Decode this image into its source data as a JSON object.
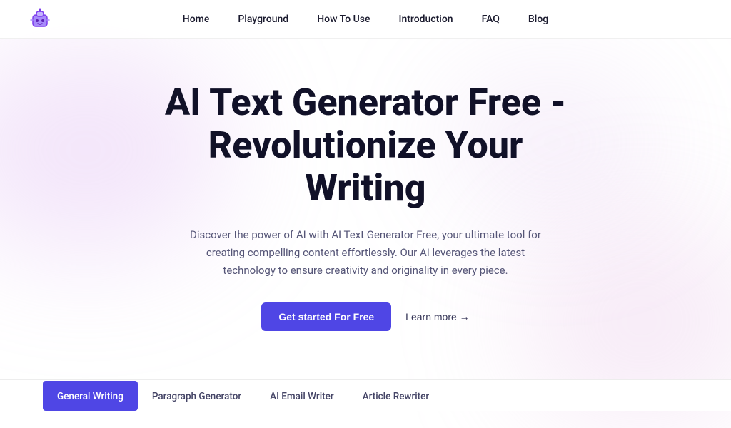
{
  "header": {
    "logo_alt": "AI Robot Logo",
    "nav": {
      "items": [
        {
          "label": "Home",
          "id": "home"
        },
        {
          "label": "Playground",
          "id": "playground"
        },
        {
          "label": "How To Use",
          "id": "how-to-use"
        },
        {
          "label": "Introduction",
          "id": "introduction"
        },
        {
          "label": "FAQ",
          "id": "faq"
        },
        {
          "label": "Blog",
          "id": "blog"
        }
      ]
    }
  },
  "hero": {
    "title": "AI Text Generator Free - Revolutionize Your Writing",
    "description": "Discover the power of AI with AI Text Generator Free, your ultimate tool for creating compelling content effortlessly. Our AI leverages the latest technology to ensure creativity and originality in every piece.",
    "cta_primary": "Get started For Free",
    "cta_secondary": "Learn more →"
  },
  "tabs": {
    "items": [
      {
        "label": "General Writing",
        "active": true
      },
      {
        "label": "Paragraph Generator",
        "active": false
      },
      {
        "label": "AI Email Writer",
        "active": false
      },
      {
        "label": "Article Rewriter",
        "active": false
      }
    ]
  },
  "colors": {
    "primary": "#4f46e5",
    "text_dark": "#111128",
    "text_muted": "#555577"
  }
}
